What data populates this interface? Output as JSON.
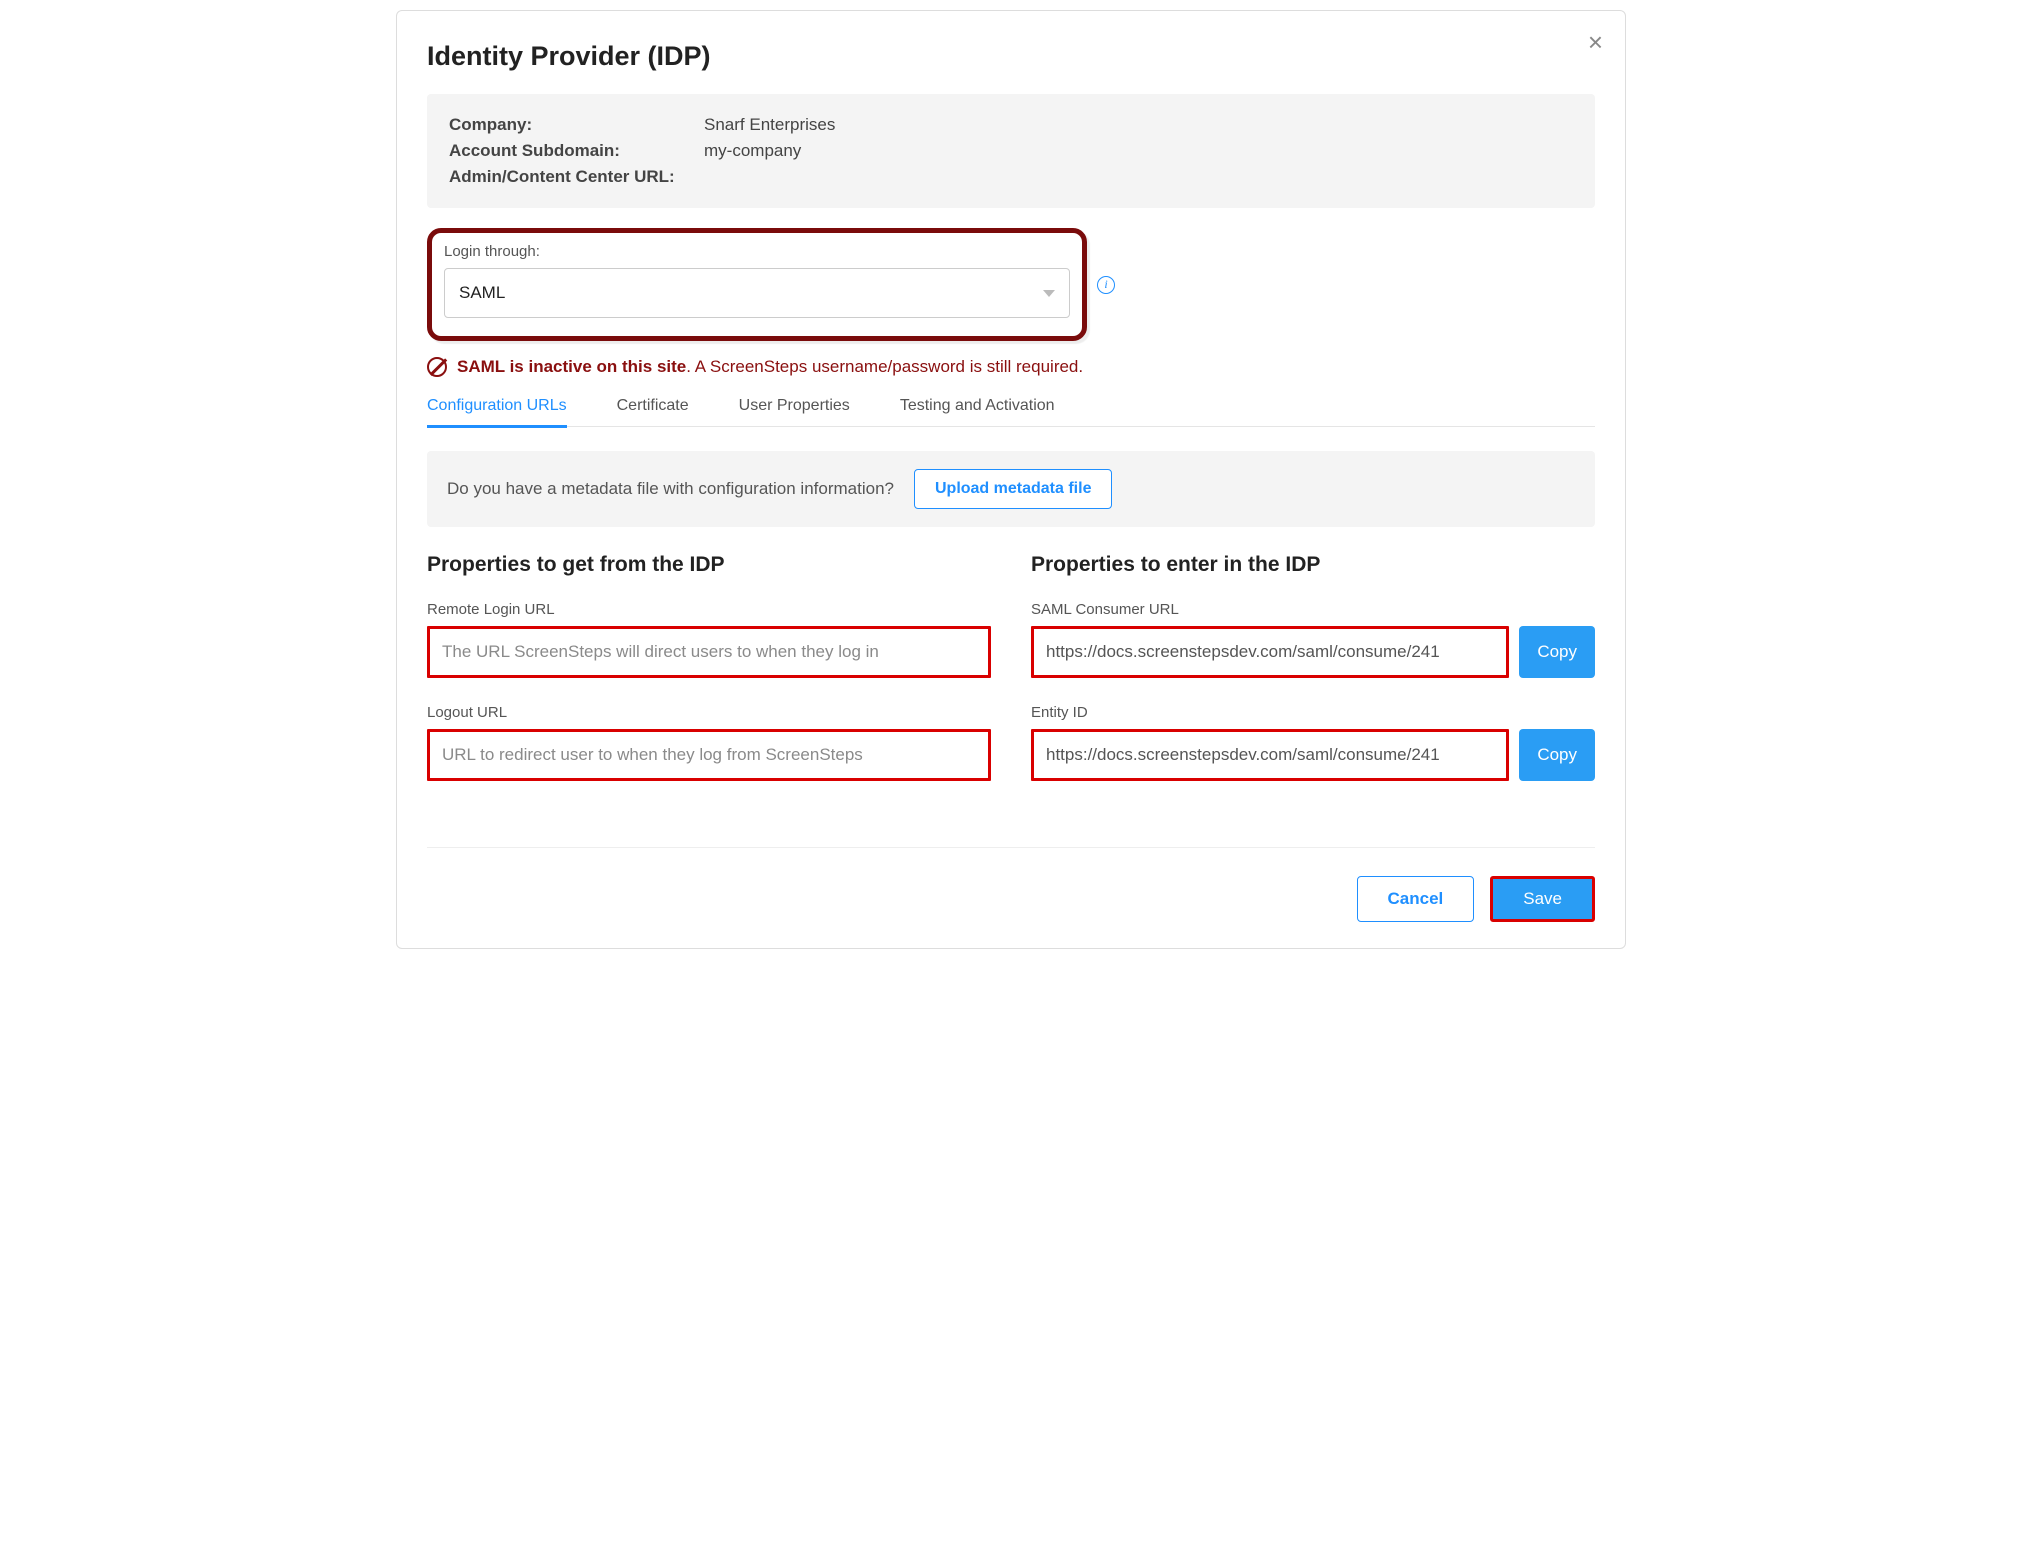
{
  "title": "Identity Provider (IDP)",
  "info": {
    "company_label": "Company:",
    "company_value": "Snarf Enterprises",
    "subdomain_label": "Account Subdomain:",
    "subdomain_value": "my-company",
    "admin_url_label": "Admin/Content Center URL:",
    "admin_url_value": ""
  },
  "login": {
    "label": "Login through:",
    "value": "SAML"
  },
  "warning": {
    "bold": "SAML is inactive on this site",
    "rest": ". A ScreenSteps username/password is still required."
  },
  "tabs": [
    {
      "label": "Configuration URLs"
    },
    {
      "label": "Certificate"
    },
    {
      "label": "User Properties"
    },
    {
      "label": "Testing and Activation"
    }
  ],
  "upload": {
    "text": "Do you have a metadata file with configuration information?",
    "button": "Upload metadata file"
  },
  "left_col": {
    "heading": "Properties to get from the IDP",
    "remote_login_label": "Remote Login URL",
    "remote_login_placeholder": "The URL ScreenSteps will direct users to when they log in",
    "logout_label": "Logout URL",
    "logout_placeholder": "URL to redirect user to when they log from ScreenSteps"
  },
  "right_col": {
    "heading": "Properties to enter in the IDP",
    "consumer_label": "SAML Consumer URL",
    "consumer_value": "https://docs.screenstepsdev.com/saml/consume/241",
    "entity_label": "Entity ID",
    "entity_value": "https://docs.screenstepsdev.com/saml/consume/241",
    "copy": "Copy"
  },
  "footer": {
    "cancel": "Cancel",
    "save": "Save"
  }
}
